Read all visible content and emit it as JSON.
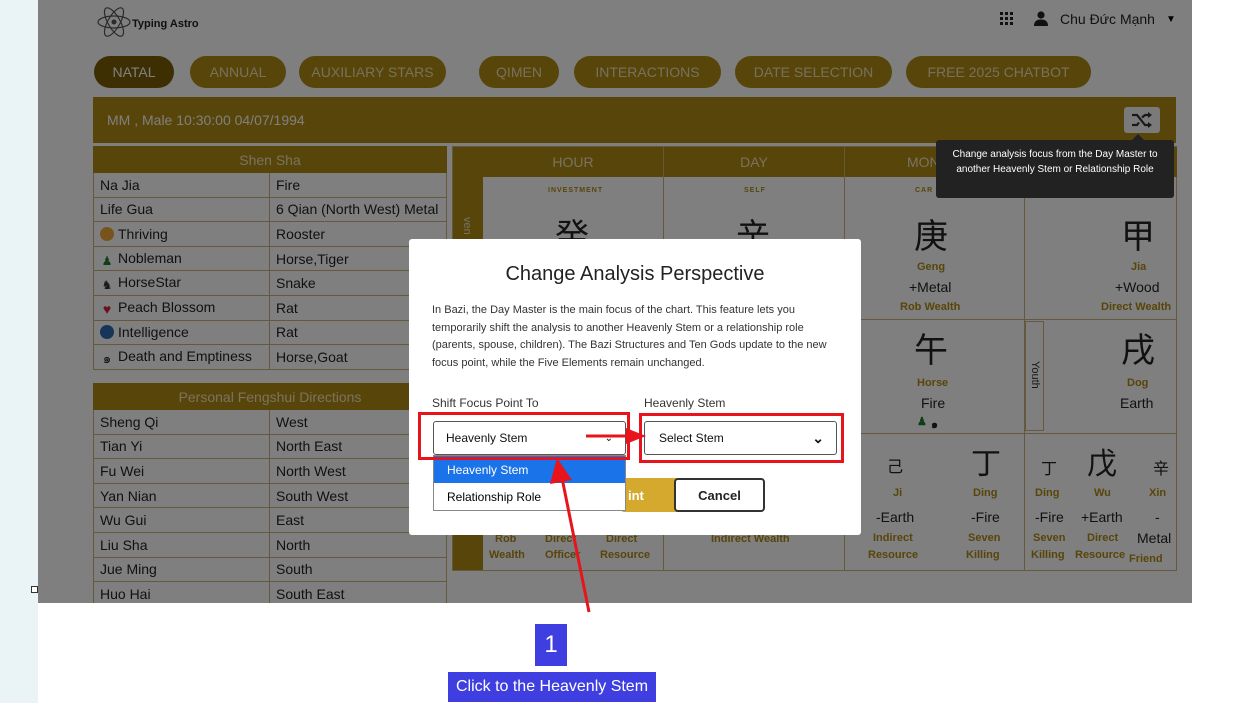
{
  "app": {
    "logo_text": "Typing Astro",
    "user_name": "Chu Đức Mạnh"
  },
  "tabs": [
    "NATAL",
    "ANNUAL",
    "AUXILIARY STARS",
    "QIMEN",
    "INTERACTIONS",
    "DATE SELECTION",
    "FREE 2025 CHATBOT"
  ],
  "banner": {
    "text": "MM , Male 10:30:00 04/07/1994"
  },
  "tooltip": {
    "text": "Change analysis focus from the Day Master to another Heavenly Stem or Relationship Role"
  },
  "shen_sha": {
    "header": "Shen Sha",
    "rows": [
      {
        "k": "Na Jia",
        "v": "Fire"
      },
      {
        "k": "Life Gua",
        "v": "6 Qian (North West) Metal"
      },
      {
        "k": "Thriving",
        "v": "Rooster"
      },
      {
        "k": "Nobleman",
        "v": "Horse,Tiger"
      },
      {
        "k": "HorseStar",
        "v": "Snake"
      },
      {
        "k": "Peach Blossom",
        "v": "Rat"
      },
      {
        "k": "Intelligence",
        "v": "Rat"
      },
      {
        "k": "Death and Emptiness",
        "v": "Horse,Goat"
      }
    ]
  },
  "fengshui": {
    "header": "Personal Fengshui Directions",
    "rows": [
      {
        "k": "Sheng Qi",
        "v": "West"
      },
      {
        "k": "Tian Yi",
        "v": "North East"
      },
      {
        "k": "Fu Wei",
        "v": "North West"
      },
      {
        "k": "Yan Nian",
        "v": "South West"
      },
      {
        "k": "Wu Gui",
        "v": "East"
      },
      {
        "k": "Liu Sha",
        "v": "North"
      },
      {
        "k": "Jue Ming",
        "v": "South"
      },
      {
        "k": "Huo Hai",
        "v": "South East"
      }
    ]
  },
  "chart": {
    "columns": [
      "HOUR",
      "DAY",
      "MON"
    ],
    "side_labels": [
      "ven",
      "Youth"
    ],
    "hour": {
      "small": "INVESTMENT",
      "char": "癸",
      "hidden_labels": [
        "Rob",
        "Direct",
        "Direct"
      ],
      "hidden_labels2": [
        "Wealth",
        "Officer",
        "Resource"
      ]
    },
    "day": {
      "small": "SELF",
      "char": "辛",
      "hidden_label": "Indirect Wealth"
    },
    "month": {
      "small": "CAR",
      "stem": {
        "char": "庚",
        "pinyin": "Geng",
        "element": "+Metal",
        "god": "Rob Wealth"
      },
      "branch": {
        "char": "午",
        "animal": "Horse",
        "element": "Fire"
      },
      "hidden": [
        {
          "char": "己",
          "pinyin": "Ji",
          "element": "-Earth",
          "god1": "Indirect",
          "god2": "Resource"
        },
        {
          "char": "丁",
          "pinyin": "Ding",
          "element": "-Fire",
          "god1": "Seven",
          "god2": "Killing"
        }
      ]
    },
    "year": {
      "stem": {
        "char": "甲",
        "pinyin": "Jia",
        "element": "+Wood",
        "god": "Direct Wealth"
      },
      "branch": {
        "char": "戌",
        "animal": "Dog",
        "element": "Earth"
      },
      "hidden": [
        {
          "char": "丁",
          "pinyin": "Ding",
          "element": "-Fire",
          "god1": "Seven",
          "god2": "Killing"
        },
        {
          "char": "戊",
          "pinyin": "Wu",
          "element": "+Earth",
          "god1": "Direct",
          "god2": "Resource"
        },
        {
          "char": "辛",
          "pinyin": "Xin",
          "element": "-",
          "god1": "Metal",
          "god2": "Friend"
        }
      ]
    }
  },
  "modal": {
    "title": "Change Analysis Perspective",
    "description": "In Bazi, the Day Master is the main focus of the chart. This feature lets you temporarily shift the analysis to another Heavenly Stem or a relationship role (parents, spouse, children). The Bazi Structures and Ten Gods update to the new focus point, while the Five Elements remain unchanged.",
    "shift_label": "Shift Focus Point To",
    "shift_value": "Heavenly Stem",
    "stem_label": "Heavenly Stem",
    "stem_value": "Select Stem",
    "options": [
      "Heavenly Stem",
      "Relationship Role"
    ],
    "confirm_partial": "int",
    "cancel": "Cancel"
  },
  "annotation": {
    "step": "1",
    "text": "Click to the Heavenly Stem",
    "color": "#3f3ee0",
    "highlight": "#e8141c"
  },
  "colors": {
    "gold": "#b08a14",
    "dark_gold": "#7c5e07"
  }
}
